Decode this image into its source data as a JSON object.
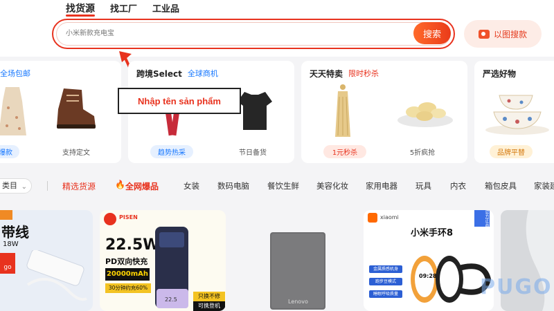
{
  "header": {
    "tabs": [
      {
        "label": "找货源",
        "active": true
      },
      {
        "label": "找工厂",
        "active": false
      },
      {
        "label": "工业品",
        "active": false
      }
    ],
    "search": {
      "placeholder": "小米新款充电宝",
      "button_label": "搜索"
    },
    "image_search_label": "以图搜款"
  },
  "annotation": {
    "text": "Nhập tên sản phẩm"
  },
  "cards": [
    {
      "title": "",
      "subtitle": "全场包邮",
      "chips": [
        "爆款",
        "支持定文"
      ]
    },
    {
      "title": "跨境Select",
      "subtitle": "全球商机",
      "chips": [
        "趋势热采",
        "节日备货"
      ]
    },
    {
      "title": "天天特卖",
      "subtitle": "限时秒杀",
      "chips": [
        "1元秒杀",
        "5折疯抢"
      ]
    },
    {
      "title": "严选好物",
      "subtitle": "",
      "chips": [
        "品牌平替"
      ]
    }
  ],
  "nav": {
    "select_label": "类目",
    "items": [
      "精选货源",
      "全网爆品",
      "女装",
      "数码电脑",
      "餐饮生鲜",
      "美容化妆",
      "家用电器",
      "玩具",
      "内衣",
      "箱包皮具",
      "家装建材"
    ]
  },
  "tiles": {
    "t1": {
      "line1": "带线",
      "line2": "18W",
      "tag": "go"
    },
    "t2": {
      "brand": "PISEN",
      "line1": "22.5W",
      "line2": "PD双向快充",
      "line3": "20000mAh",
      "line4": "30分钟约充60%",
      "badge1": "只换不修",
      "badge2": "可携登机",
      "cell_label": "22.5"
    },
    "t3": {
      "brand": "Lenovo"
    },
    "t4": {
      "brand": "小米手环8",
      "logo_text": "xiaomi",
      "tags": [
        "金属质感机身",
        "跑步豆模式",
        "睡眠呼吸质量"
      ],
      "corner": "官方正品",
      "time": "09:28"
    }
  },
  "watermark": "PUGO",
  "colors": {
    "accent": "#e8321e",
    "link": "#1677ff"
  }
}
